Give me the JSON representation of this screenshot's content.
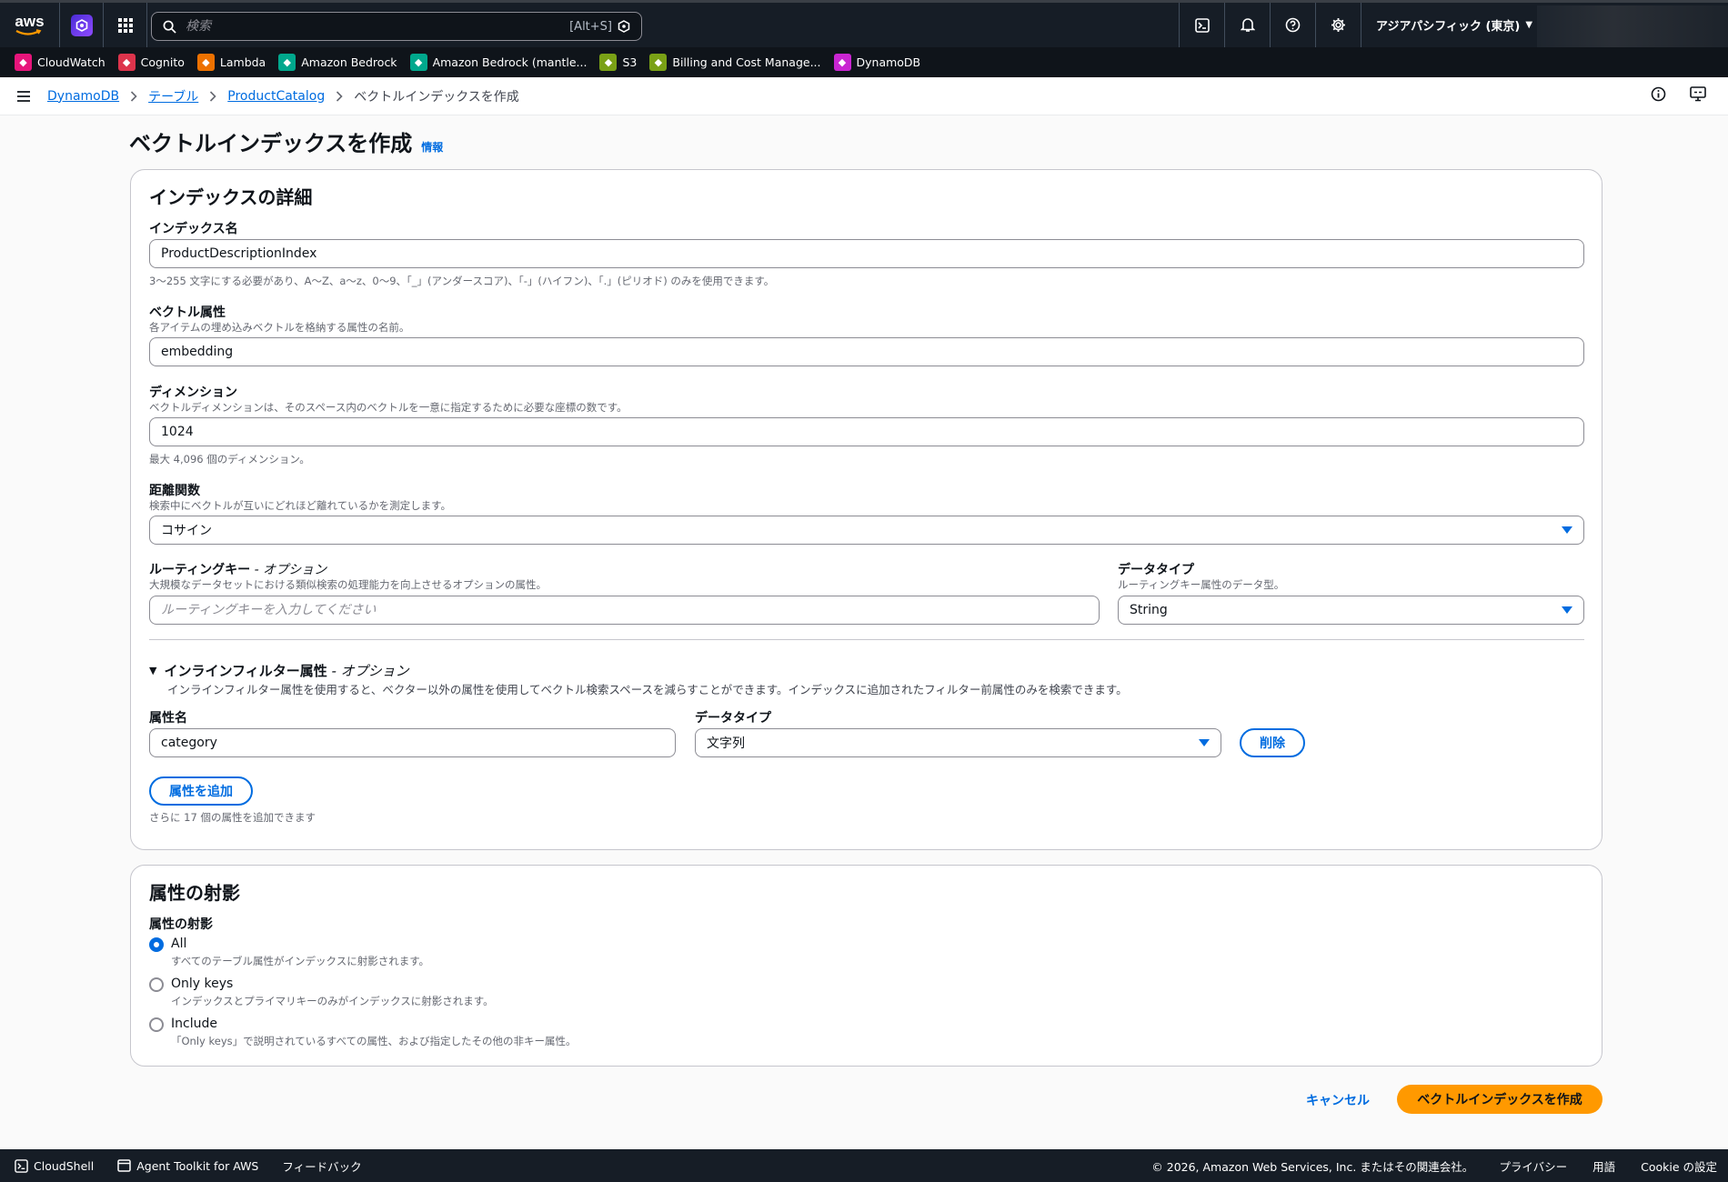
{
  "topnav": {
    "logo_text": "aws",
    "search_placeholder": "検索",
    "search_shortcut": "[Alt+S]",
    "region": "アジアパシフィック (東京)"
  },
  "favorites": [
    {
      "label": "CloudWatch",
      "color": "#e7157b"
    },
    {
      "label": "Cognito",
      "color": "#dd344c"
    },
    {
      "label": "Lambda",
      "color": "#ed7100"
    },
    {
      "label": "Amazon Bedrock",
      "color": "#01a88d"
    },
    {
      "label": "Amazon Bedrock (mantle...",
      "color": "#01a88d"
    },
    {
      "label": "S3",
      "color": "#7aa116"
    },
    {
      "label": "Billing and Cost Manage...",
      "color": "#7aa116"
    },
    {
      "label": "DynamoDB",
      "color": "#c925d1"
    }
  ],
  "breadcrumb": {
    "items": [
      "DynamoDB",
      "テーブル",
      "ProductCatalog"
    ],
    "current": "ベクトルインデックスを作成"
  },
  "page": {
    "title": "ベクトルインデックスを作成",
    "info": "情報"
  },
  "details": {
    "heading": "インデックスの詳細",
    "index_name": {
      "label": "インデックス名",
      "value": "ProductDescriptionIndex",
      "hint": "3〜255 文字にする必要があり、A〜Z、a〜z、0〜9、「_」(アンダースコア)、「-」(ハイフン)、「.」(ピリオド) のみを使用できます。"
    },
    "vector_attr": {
      "label": "ベクトル属性",
      "desc": "各アイテムの埋め込みベクトルを格納する属性の名前。",
      "value": "embedding"
    },
    "dimension": {
      "label": "ディメンション",
      "desc": "ベクトルディメンションは、そのスペース内のベクトルを一意に指定するために必要な座標の数です。",
      "value": "1024",
      "hint": "最大 4,096 個のディメンション。"
    },
    "distance": {
      "label": "距離関数",
      "desc": "検索中にベクトルが互いにどれほど離れているかを測定します。",
      "value": "コサイン"
    },
    "routing_key": {
      "label": "ルーティングキー",
      "optional": " - オプション",
      "desc": "大規模なデータセットにおける類似検索の処理能力を向上させるオプションの属性。",
      "placeholder": "ルーティングキーを入力してください"
    },
    "routing_type": {
      "label": "データタイプ",
      "desc": "ルーティングキー属性のデータ型。",
      "value": "String"
    },
    "inline_filter": {
      "label": "インラインフィルター属性",
      "optional": " - オプション",
      "desc": "インラインフィルター属性を使用すると、ベクター以外の属性を使用してベクトル検索スペースを減らすことができます。インデックスに追加されたフィルター前属性のみを検索できます。",
      "attr_name_label": "属性名",
      "attr_name_value": "category",
      "data_type_label": "データタイプ",
      "data_type_value": "文字列",
      "remove": "削除",
      "add": "属性を追加",
      "remaining": "さらに 17 個の属性を追加できます"
    }
  },
  "projection": {
    "heading": "属性の射影",
    "label": "属性の射影",
    "options": [
      {
        "label": "All",
        "desc": "すべてのテーブル属性がインデックスに射影されます。",
        "selected": true
      },
      {
        "label": "Only keys",
        "desc": "インデックスとプライマリキーのみがインデックスに射影されます。",
        "selected": false
      },
      {
        "label": "Include",
        "desc": "「Only keys」で説明されているすべての属性、および指定したその他の非キー属性。",
        "selected": false
      }
    ]
  },
  "actions": {
    "cancel": "キャンセル",
    "create": "ベクトルインデックスを作成"
  },
  "footer": {
    "cloudshell": "CloudShell",
    "agent_toolkit": "Agent Toolkit for AWS",
    "feedback": "フィードバック",
    "copyright": "© 2026, Amazon Web Services, Inc. またはその関連会社。",
    "privacy": "プライバシー",
    "terms": "用語",
    "cookie": "Cookie の設定"
  }
}
